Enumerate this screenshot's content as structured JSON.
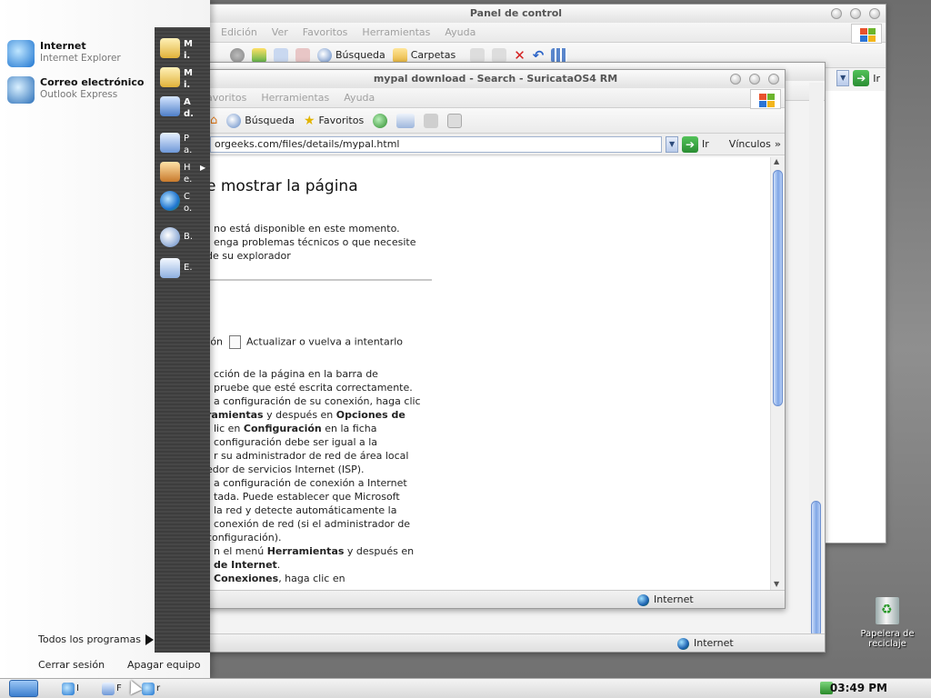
{
  "back_window": {
    "title": "Panel de control",
    "menu": [
      "Edición",
      "Ver",
      "Favoritos",
      "Herramientas",
      "Ayuda"
    ],
    "toolbar": {
      "search": "Búsqueda",
      "folders": "Carpetas"
    },
    "go": "Ir"
  },
  "mid_window": {
    "menu": [
      "avoritos",
      "Herramientas",
      "Ayuda"
    ],
    "status_zone": "Internet"
  },
  "front_window": {
    "title": "mypal download - Search - SuricataOS4 RM",
    "toolbar": {
      "search": "Búsqueda",
      "favorites": "Favoritos"
    },
    "address": "orgeeks.com/files/details/mypal.html",
    "go": "Ir",
    "links": "Vínculos",
    "status_zone": "Internet",
    "content": {
      "title": "e mostrar la página",
      "lines": [
        "no está disponible en este momento.",
        "enga problemas técnicos o que necesite",
        "de su explorador"
      ],
      "refresh_line": {
        "before": "tón",
        "after": "Actualizar o vuelva a intentarlo"
      },
      "steps": [
        "cción de la página en la barra de",
        "pruebe que esté escrita correctamente.",
        "a configuración de su conexión, haga clic",
        "ramientas|| y después en ||Opciones de",
        "lic en ||Configuración|| en la ficha",
        "configuración debe ser igual a la",
        "r su administrador de red de área local",
        "edor de servicios Internet (ISP).",
        "a configuración de conexión a Internet",
        "tada. Puede establecer que Microsoft",
        " la red y detecte automáticamente la",
        "conexión de red (si el administrador de",
        "configuración).",
        "n el menú ||Herramientas|| y después en",
        "de Internet||.",
        "Conexiones||, haga clic en"
      ]
    }
  },
  "start_menu": {
    "pinned": [
      {
        "title": "Internet",
        "subtitle": "Internet Explorer"
      },
      {
        "title": "Correo electrónico",
        "subtitle": "Outlook Express"
      }
    ],
    "right_items": [
      {
        "text": "Mi.",
        "icon": "documents-folder-icon"
      },
      {
        "text": "Mi.",
        "icon": "pictures-folder-icon"
      },
      {
        "text": "Ad.",
        "icon": "computer-icon"
      },
      {
        "text": "Pa.",
        "icon": "control-panel-icon"
      },
      {
        "text": "He.",
        "icon": "printers-icon"
      },
      {
        "text": "Co.",
        "icon": "connect-icon"
      },
      {
        "text": "B.",
        "icon": "search-icon"
      },
      {
        "text": "E.",
        "icon": "run-icon"
      }
    ],
    "all_programs": "Todos los programas",
    "logoff": "Cerrar sesión",
    "shutdown": "Apagar equipo"
  },
  "taskbar": {
    "tasks": [
      "I",
      "F",
      "r"
    ],
    "clock": "03:49 PM"
  },
  "desktop": {
    "recycle_bin": "Papelera de reciclaje"
  },
  "colors": {
    "accent_blue": "#3c7fcf",
    "go_green": "#2a8d33",
    "start_column": "#3d3d3d"
  }
}
